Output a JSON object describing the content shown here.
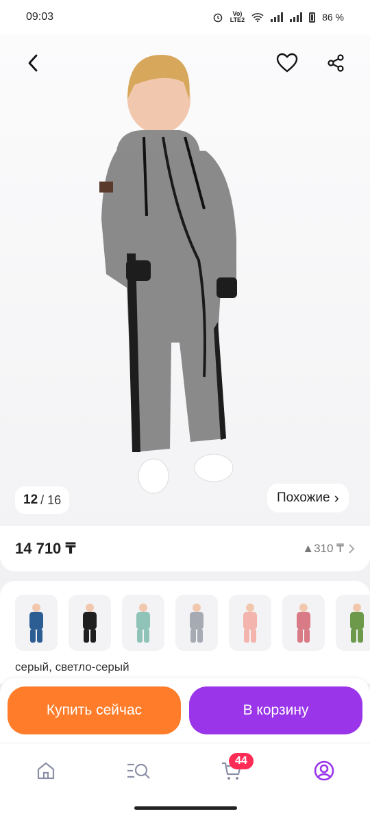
{
  "status": {
    "time": "09:03",
    "battery": "86 %",
    "network": "Vo) LTE2"
  },
  "gallery": {
    "current": "12",
    "total": "/ 16",
    "similar_label": "Похожие",
    "similar_chevron": "›"
  },
  "price": {
    "value": "14 710 ₸",
    "change": "▲310 ₸"
  },
  "variants": {
    "label": "серый, светло-серый",
    "items": [
      {
        "color": "#2d5e93"
      },
      {
        "color": "#1f1f1f"
      },
      {
        "color": "#8fc3b8"
      },
      {
        "color": "#a6aab2"
      },
      {
        "color": "#f2b4ac"
      },
      {
        "color": "#d97b86"
      },
      {
        "color": "#6c9a4a"
      }
    ]
  },
  "actions": {
    "buy_now": "Купить сейчас",
    "add_to_cart": "В корзину"
  },
  "nav": {
    "cart_badge": "44"
  },
  "colors": {
    "buy": "#ff7d2a",
    "cart": "#9a35ea",
    "active_nav": "#9a35ea",
    "badge": "#ff2d55"
  }
}
